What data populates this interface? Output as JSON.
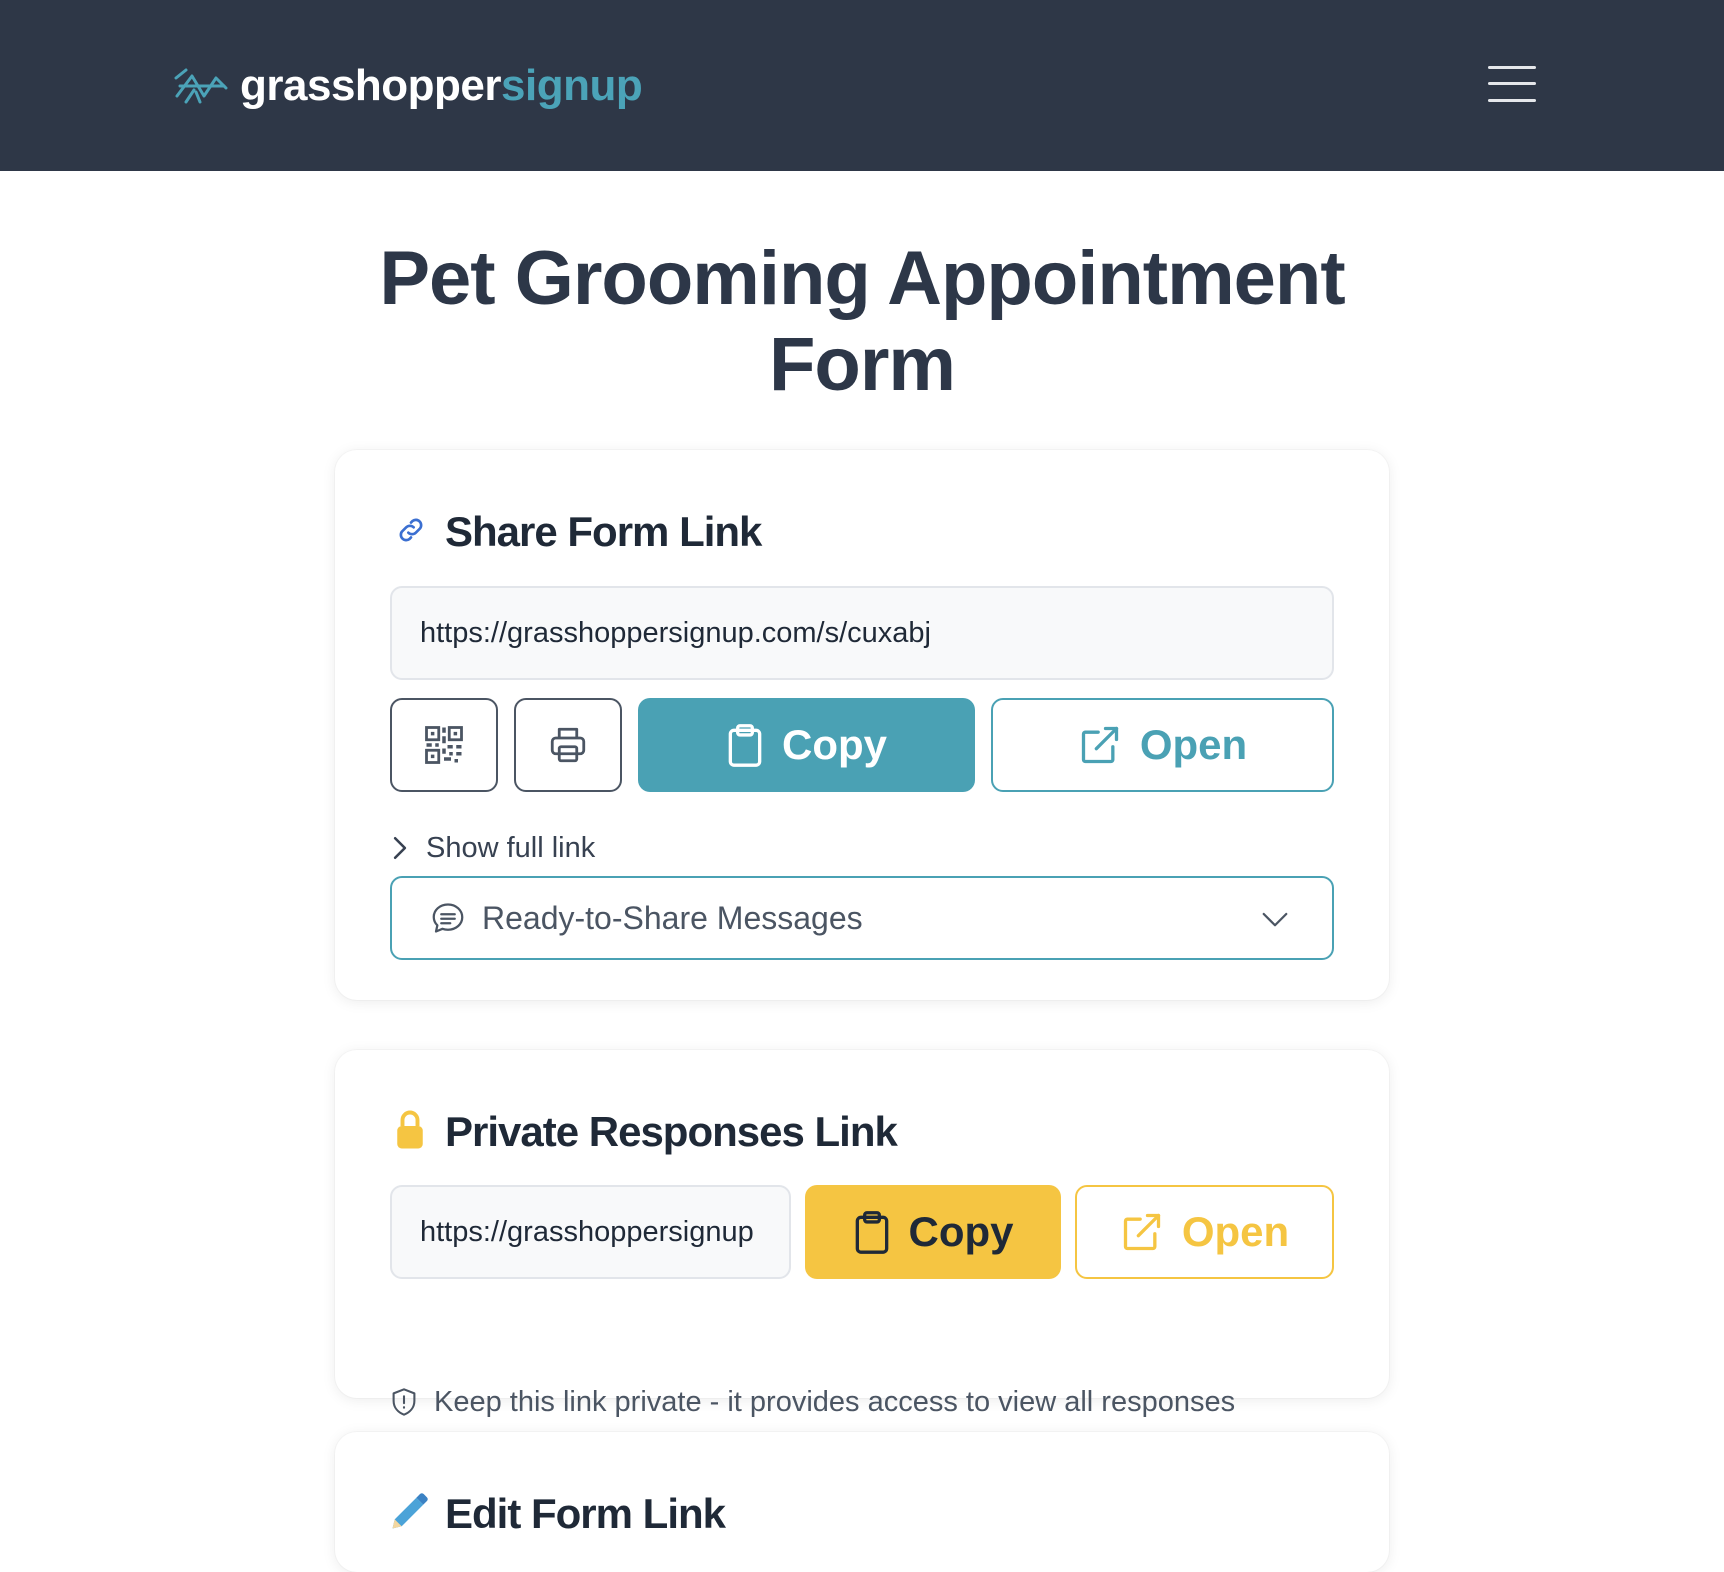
{
  "header": {
    "logo_part1": "grasshopper",
    "logo_part2": "signup",
    "menu_icon": "hamburger-menu-icon"
  },
  "page": {
    "title_line1": "Pet Grooming Appointment",
    "title_line2": "Form"
  },
  "share_card": {
    "title": "Share Form Link",
    "icon": "link-icon",
    "url": "https://grasshoppersignup.com/s/cuxabj",
    "copy_label": "Copy",
    "open_label": "Open",
    "show_full_link": "Show full link",
    "messages_dropdown": "Ready-to-Share Messages"
  },
  "private_card": {
    "title": "Private Responses Link",
    "icon": "lock-icon",
    "url": "https://grasshoppersignup",
    "copy_label": "Copy",
    "open_label": "Open",
    "note": "Keep this link private - it provides access to view all responses"
  },
  "edit_card": {
    "title": "Edit Form Link",
    "icon": "pencil-icon"
  },
  "colors": {
    "header_bg": "#2e3747",
    "teal": "#4aa1b4",
    "yellow": "#f5c542"
  }
}
